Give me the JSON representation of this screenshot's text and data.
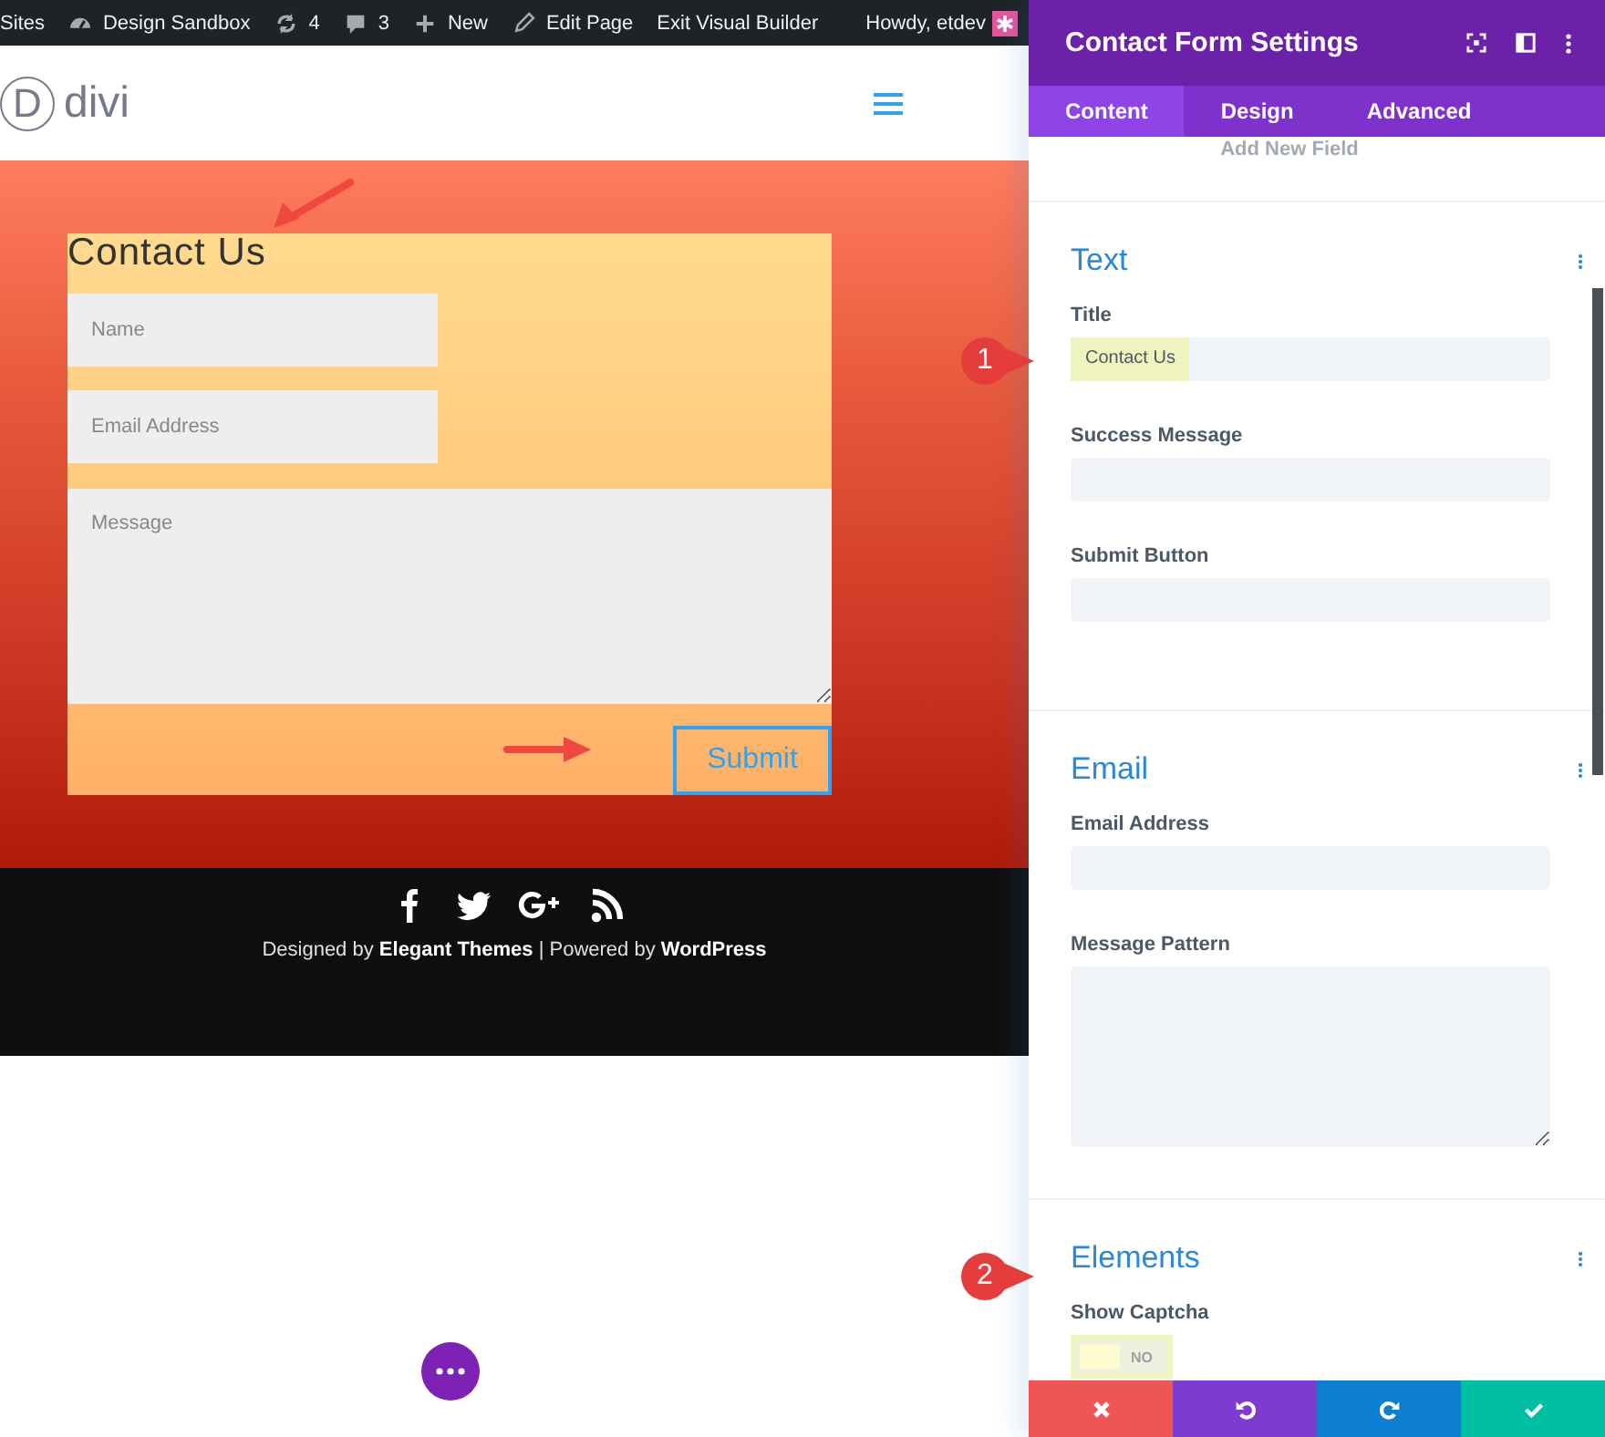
{
  "admin_bar": {
    "items": [
      {
        "kind": "text",
        "label": "Sites"
      },
      {
        "kind": "dashboard",
        "label": "Design Sandbox"
      },
      {
        "kind": "updates",
        "label": "4"
      },
      {
        "kind": "comments",
        "label": "3"
      },
      {
        "kind": "new",
        "label": "New"
      },
      {
        "kind": "edit",
        "label": "Edit Page"
      },
      {
        "kind": "text",
        "label": "Exit Visual Builder"
      }
    ],
    "greeting": "Howdy, etdev"
  },
  "header": {
    "logo_letter": "D",
    "logo_text": "divi"
  },
  "form": {
    "title": "Contact Us",
    "fields": [
      {
        "kind": "input",
        "placeholder": "Name"
      },
      {
        "kind": "input",
        "placeholder": "Email Address"
      },
      {
        "kind": "textarea",
        "placeholder": "Message"
      }
    ],
    "submit": "Submit"
  },
  "footer": {
    "social": [
      {
        "kind": "facebook"
      },
      {
        "kind": "twitter"
      },
      {
        "kind": "googleplus"
      },
      {
        "kind": "rss"
      }
    ],
    "credit": "Designed by **Elegant Themes** | Powered by **WordPress**"
  },
  "panel": {
    "title": "Contact Form Settings",
    "tabs": [
      {
        "label": "Content",
        "selected": true
      },
      {
        "label": "Design",
        "selected": false
      },
      {
        "label": "Advanced",
        "selected": false
      }
    ],
    "add_field": "Add New Field",
    "sections": [
      {
        "title": "Text",
        "fields": [
          {
            "kind": "input",
            "label": "Title",
            "value": "Contact Us",
            "highlighted": true
          },
          {
            "kind": "input",
            "label": "Success Message",
            "highlighted": false
          },
          {
            "kind": "input",
            "label": "Submit Button",
            "highlighted": false
          }
        ]
      },
      {
        "title": "Email",
        "fields": [
          {
            "kind": "input",
            "label": "Email Address",
            "highlighted": false
          },
          {
            "kind": "textarea",
            "label": "Message Pattern",
            "highlighted": false
          }
        ]
      },
      {
        "title": "Elements",
        "fields": [
          {
            "kind": "toggle",
            "label": "Show Captcha",
            "on": false,
            "state_label": "NO",
            "highlighted": true
          }
        ]
      }
    ],
    "actions": [
      {
        "kind": "cancel",
        "color": "#ef5555"
      },
      {
        "kind": "undo",
        "color": "#7e3bd0"
      },
      {
        "kind": "redo",
        "color": "#0c7fd0"
      },
      {
        "kind": "save",
        "color": "#00bfa5"
      }
    ]
  },
  "callouts": [
    {
      "number": "1"
    },
    {
      "number": "2"
    }
  ]
}
